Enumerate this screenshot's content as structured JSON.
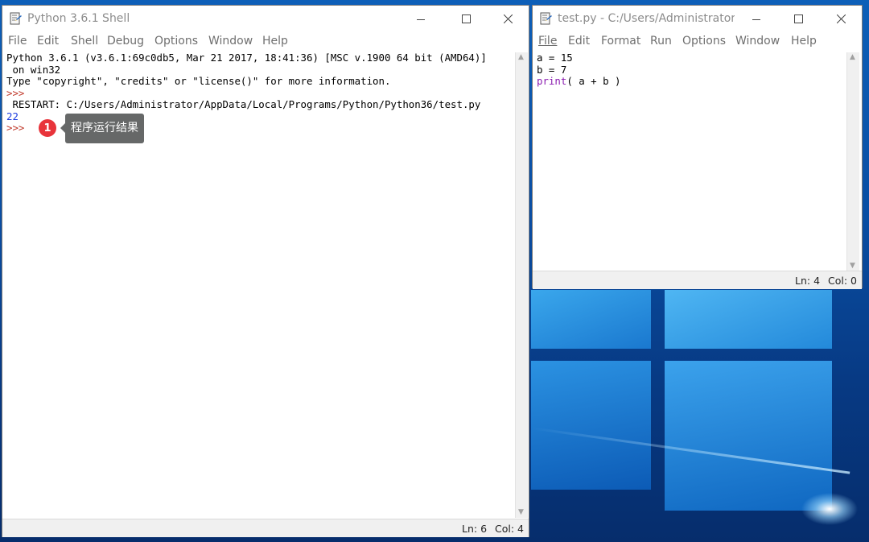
{
  "shell": {
    "title": "Python 3.6.1 Shell",
    "menu": [
      "File",
      "Edit",
      "Shell",
      "Debug",
      "Options",
      "Window",
      "Help"
    ],
    "lines": [
      {
        "text": "Python 3.6.1 (v3.6.1:69c0db5, Mar 21 2017, 18:41:36) [MSC v.1900 64 bit (AMD64)]",
        "color": "#000000"
      },
      {
        "text": " on win32",
        "color": "#000000"
      },
      {
        "text": "Type \"copyright\", \"credits\" or \"license()\" for more information.",
        "color": "#000000"
      },
      {
        "text": ">>> ",
        "color": "#c0392b"
      },
      {
        "text": " RESTART: C:/Users/Administrator/AppData/Local/Programs/Python/Python36/test.py",
        "color": "#000000"
      },
      {
        "text": "22",
        "color": "#1f3ee0"
      },
      {
        "text": ">>> ",
        "color": "#c0392b"
      }
    ],
    "status": {
      "ln": "Ln: 6",
      "col": "Col: 4"
    }
  },
  "editor": {
    "title": "test.py - C:/Users/Administrator...",
    "menu": [
      "File",
      "Edit",
      "Format",
      "Run",
      "Options",
      "Window",
      "Help"
    ],
    "code": [
      {
        "parts": [
          {
            "text": "a = 15",
            "color": "#000000"
          }
        ]
      },
      {
        "parts": [
          {
            "text": "b = 7",
            "color": "#000000"
          }
        ]
      },
      {
        "parts": [
          {
            "text": "print",
            "color": "#8a1bb0"
          },
          {
            "text": "( a + b )",
            "color": "#000000"
          }
        ]
      }
    ],
    "status": {
      "ln": "Ln: 4",
      "col": "Col: 0"
    }
  },
  "annotation": {
    "number": "1",
    "text": "程序运行结果"
  },
  "colors": {
    "prompt": "#c0392b",
    "output": "#1f3ee0",
    "builtin": "#8a1bb0",
    "badge": "#e8343b"
  }
}
